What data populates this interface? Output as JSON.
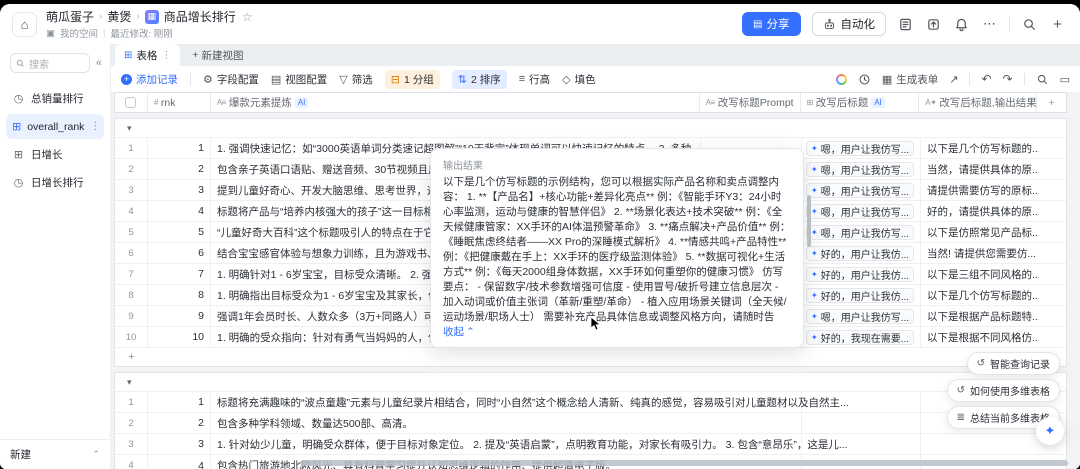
{
  "header": {
    "breadcrumb": [
      "萌瓜蛋子",
      "黄煲",
      "商品增长排行"
    ],
    "space": "我的空间",
    "modified": "最近修改: 刚刚",
    "share": "分享",
    "automation": "自动化"
  },
  "sidebar": {
    "search_placeholder": "搜索",
    "collapse": "«",
    "items": [
      {
        "label": "总销量排行",
        "icon": "clock"
      },
      {
        "label": "overall_rank",
        "icon": "table"
      },
      {
        "label": "日增长",
        "icon": "table"
      },
      {
        "label": "日增长排行",
        "icon": "clock"
      }
    ],
    "new_label": "新建"
  },
  "views": {
    "tab": "表格",
    "new_view": "新建视图"
  },
  "toolbar": {
    "add_record": "添加记录",
    "field_config": "字段配置",
    "view_config": "视图配置",
    "filter": "筛选",
    "group": "1 分组",
    "sort": "2 排序",
    "row_height": "行高",
    "fill": "填色",
    "generate_form": "生成表单"
  },
  "table": {
    "columns": {
      "rnk": "rnk",
      "element": "爆款元素提炼",
      "prompt": "改写标题Prompt",
      "rewrite": "改写后标题",
      "output": "改写后标题,输出结果",
      "ai_badge": "AI",
      "add_column": "+"
    },
    "groups": [
      {
        "has_add_row": true,
        "rows": [
          {
            "num": "1",
            "rnk": "1",
            "element": "1. 强调快速记忆：如“3000英语单词分类速记超图解”“10天背完”体现单词可以快速记忆的特点。 2. 多种",
            "tag": "嗯，用户让我仿写...",
            "output": "以下是几个仿写标题的..."
          },
          {
            "num": "2",
            "rnk": "2",
            "element": "包含亲子英语口语贴、赠送音频、30节视频且用于英语启蒙。",
            "tag": "嗯，用户让我仿写...",
            "output": "当然，请提供具体的原..."
          },
          {
            "num": "3",
            "rnk": "3",
            "element": "提到儿童好奇心、开发大脑思维、思考世界，这些元素能够吸引家长关注孩子的成长与发展，满足对孩",
            "tag": "嗯，用户让我仿写...",
            "output": "请提供需要仿写的原标..."
          },
          {
            "num": "4",
            "rnk": "4",
            "element": "标题将产品与“培养内核强大的孩子”这一目标相联系，“自信的红外”表述独特，容易引发好奇，“中信出",
            "tag": "嗯，用户让我仿写...",
            "output": "好的，请提供具体的原..."
          },
          {
            "num": "5",
            "rnk": "5",
            "element": "“儿童好奇大百科”这个标题吸引人的特点在于它直接点明了受众是儿童，且“好奇”一词能够激发儿童的",
            "tag": "嗯，用户让我仿写...",
            "output": "以下是仿照常见产品标..."
          },
          {
            "num": "6",
            "rnk": "6",
            "element": "结合宝宝感官体验与想象力训练，且为游戏书、平装6册。",
            "tag": "好的，用户让我仿...",
            "output": "当然! 请提供您需要仿..."
          },
          {
            "num": "7",
            "rnk": "7",
            "element": "1. 明确针对1 - 6岁宝宝，目标受众清晰。 2. 强调“好习惯养成”“行为习惯早教启蒙”，抓住家长重视孩子",
            "tag": "好的，用户让我仿...",
            "output": "以下是三组不同风格的..."
          },
          {
            "num": "8",
            "rnk": "8",
            "element": "1. 明确指出目标受众为1 - 6岁宝宝及其家长，体现针对性。 2. 强调“好习惯养成”、“行为习惯早教启蒙",
            "tag": "好的，用户让我仿...",
            "output": "以下是几个仿写标题的..."
          },
          {
            "num": "9",
            "rnk": "9",
            "element": "强调1年会员时长、人数众多（3万+同路人）可共同打破信息茧房的社群优势。",
            "tag": "嗯，用户让我仿写...",
            "output": "以下是根据产品标题特..."
          },
          {
            "num": "10",
            "rnk": "10",
            "element": "1. 明确的受众指向：针对有勇气当妈妈的人，使特定人群容易产生共鸣。 2. 情感性表达：“亲爱的宝贝",
            "tag": "好的，我现在需要...",
            "output": "以下是根据不同风格仿..."
          }
        ]
      },
      {
        "has_add_row": false,
        "rows": [
          {
            "num": "1",
            "rnk": "1",
            "element": "标题将充满趣味的“波点童趣”元素与儿童纪录片相结合，同时“小自然”这个概念给人清新、纯真的感觉，容易吸引对儿童题材以及自然主...",
            "overflow": true
          },
          {
            "num": "2",
            "rnk": "2",
            "element": "包含多种学科领域、数量达500部、高清。",
            "overflow": true
          },
          {
            "num": "3",
            "rnk": "3",
            "element": "1. 针对幼少儿童，明确受众群体，便于目标对象定位。 2. 提及“英语启蒙”，点明教育功能，对家长有吸引力。 3. 包含“意昂乐”，这是儿...",
            "overflow": true
          },
          {
            "num": "4",
            "rnk": "4",
            "element": "包含热门旅游地北欧风光、具有科普学习提升认知思维逻辑的作用、提供超清电子版。",
            "overflow": true
          }
        ]
      }
    ]
  },
  "popup": {
    "title": "输出结果",
    "body": "以下是几个仿写标题的示例结构，您可以根据实际产品名称和卖点调整内容： 1. **【产品名】+核心功能+差异化亮点** 例：《智能手环Y3：24小时心率监测，运动与健康的智慧伴侣》 2. **场景化表达+技术突破** 例：《全天候健康管家：XX手环的AI体温预警革命》 3. **痛点解决+产品价值** 例：《睡眠焦虑终结者——XX Pro的深睡模式解析》 4. **情感共鸣+产品特性** 例：《把健康戴在手上：XX手环的医疗级监测体验》 5. **数据可视化+生活方式** 例：《每天2000组身体数据，XX手环如何重塑你的健康习惯》 仿写要点： - 保留数字/技术参数增强可信度 - 使用冒号/破折号建立信息层次 - 加入动词或价值主张词（革新/重塑/革命） - 植入应用场景关键词（全天候/运动场景/职场人士） 需要补充产品具体信息或调整风格方向，请随时告知。",
    "collapse": "收起"
  },
  "assistant": {
    "pills": [
      "智能查询记录",
      "如何使用多维表格",
      "总结当前多维表格"
    ]
  },
  "colors": {
    "accent": "#3370ff",
    "group_pill": "#fdf0dc",
    "sort_pill": "#e4ecff"
  }
}
